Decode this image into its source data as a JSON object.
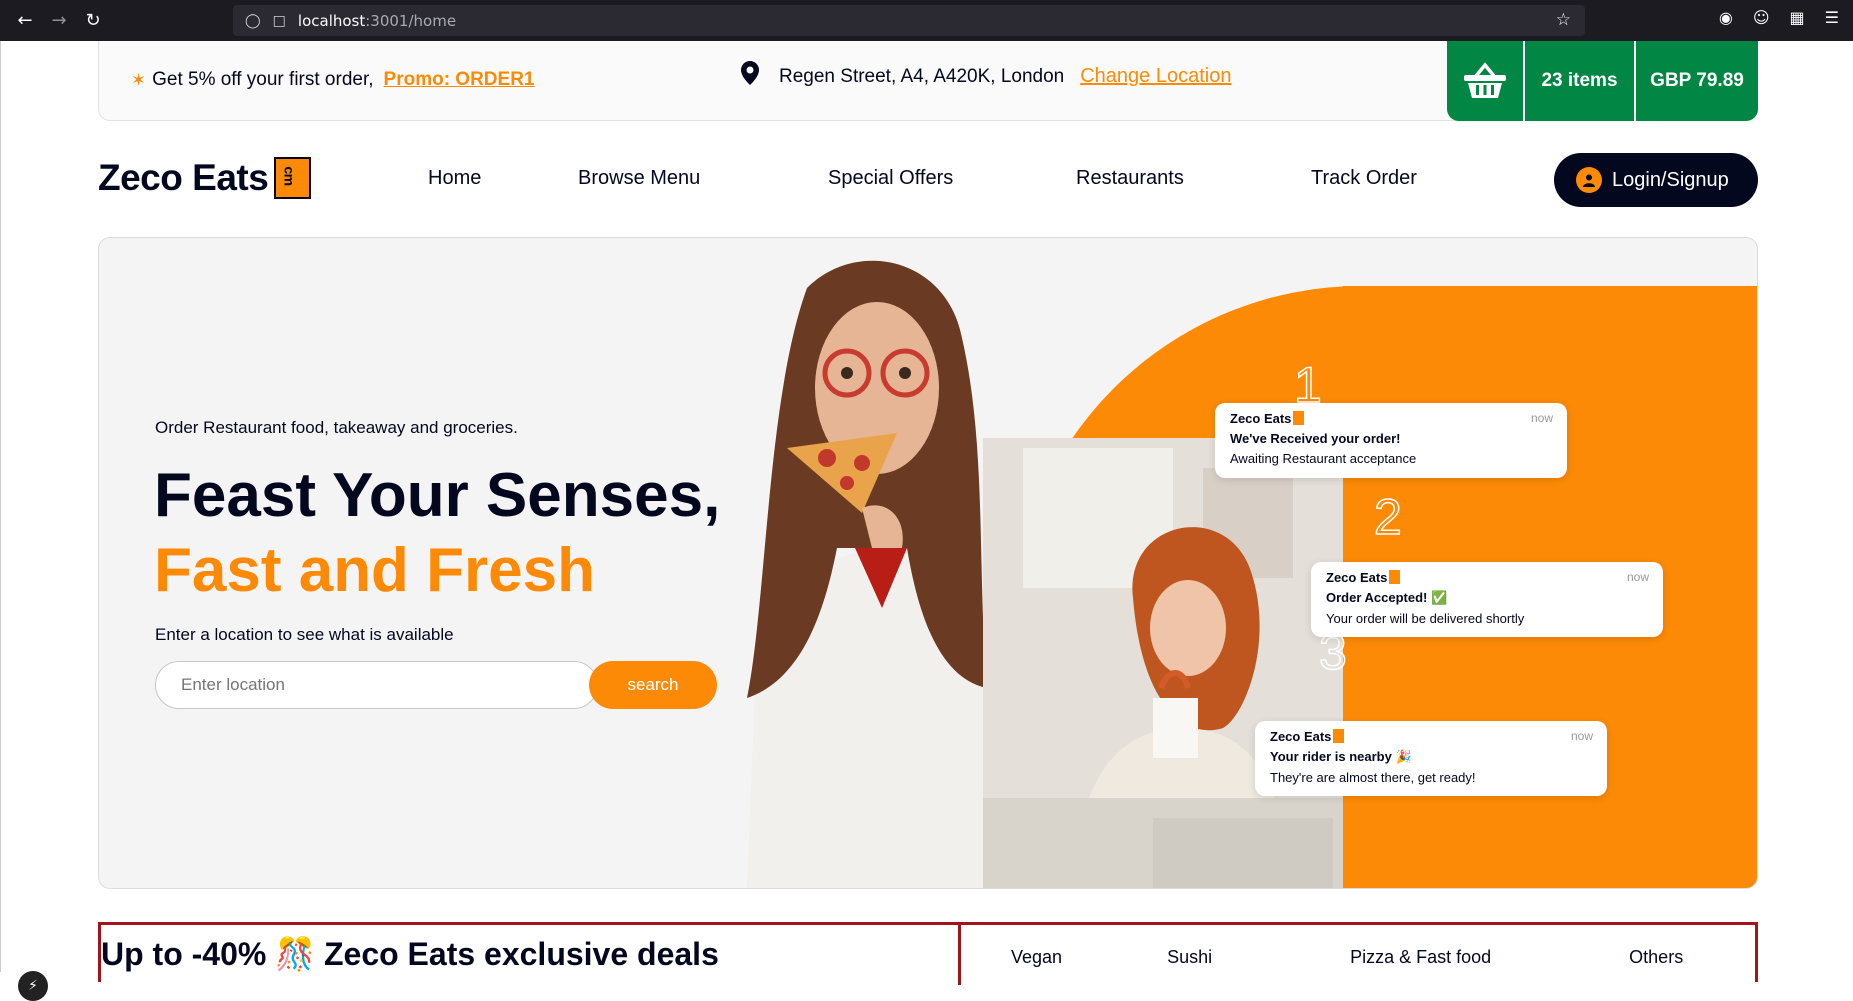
{
  "browser": {
    "url_host": "localhost",
    "url_path": ":3001/home"
  },
  "topbar": {
    "promo_text": "Get 5% off your first order,",
    "promo_code": "Promo: ORDER1",
    "address": "Regen Street, A4, A420K, London",
    "change_location": "Change Location",
    "cart_items": "23 items",
    "cart_total": "GBP 79.89"
  },
  "nav": {
    "logo": "Zeco Eats",
    "logo_badge": "cm",
    "items": [
      "Home",
      "Browse Menu",
      "Special Offers",
      "Restaurants",
      "Track Order"
    ],
    "login": "Login/Signup"
  },
  "hero": {
    "subline": "Order Restaurant food, takeaway and groceries.",
    "headline_1": "Feast Your Senses,",
    "headline_2": "Fast and Fresh",
    "prompt": "Enter a location to see what is available",
    "search_placeholder": "Enter location",
    "search_button": "search",
    "notifications": [
      {
        "step": "1",
        "app": "Zeco Eats",
        "time": "now",
        "heading": "We've Received your order!",
        "body": "Awaiting Restaurant acceptance"
      },
      {
        "step": "2",
        "app": "Zeco Eats",
        "time": "now",
        "heading": "Order Accepted! ✅",
        "body": "Your order will be delivered shortly"
      },
      {
        "step": "3",
        "app": "Zeco Eats",
        "time": "now",
        "heading": "Your rider is nearby 🎉",
        "body": "They're are almost there, get ready!"
      }
    ]
  },
  "deals": {
    "title": "Up to -40% 🎊 Zeco Eats exclusive deals",
    "categories": [
      "Vegan",
      "Sushi",
      "Pizza & Fast food",
      "Others"
    ]
  },
  "colors": {
    "accent": "#fc8a06",
    "dark": "#03081f",
    "green": "#028643",
    "deals_border": "#a3131b"
  }
}
